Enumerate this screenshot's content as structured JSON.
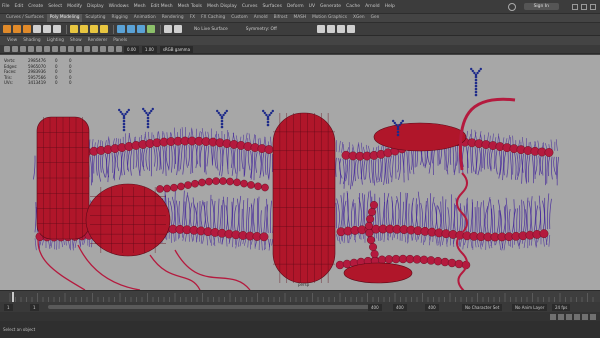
{
  "menubar": {
    "items": [
      "File",
      "Edit",
      "Create",
      "Select",
      "Modify",
      "Display",
      "Windows",
      "Mesh",
      "Edit Mesh",
      "Mesh Tools",
      "Mesh Display",
      "Curves",
      "Surfaces",
      "Deform",
      "UV",
      "Generate",
      "Cache",
      "Arnold",
      "Help"
    ],
    "sign_in": "Sign In"
  },
  "shelf_tabs": {
    "items": [
      "Curves / Surfaces",
      "Poly Modeling",
      "Sculpting",
      "Rigging",
      "Animation",
      "Rendering",
      "FX",
      "FX Caching",
      "Custom",
      "Arnold",
      "Bifrost",
      "MASH",
      "Motion Graphics",
      "XGen",
      "Gen"
    ],
    "active_index": 1
  },
  "status_line": {
    "surface_mode": "No Live Surface",
    "symmetry": "Symmetry: Off"
  },
  "viewport_menu": {
    "items": [
      "View",
      "Shading",
      "Lighting",
      "Show",
      "Renderer",
      "Panels"
    ]
  },
  "viewport_toolbar": {
    "exposure": "0.00",
    "gamma": "1.00",
    "color_space": "sRGB gamma"
  },
  "hud": {
    "rows": [
      {
        "label": "Verts:",
        "a": "2985476",
        "b": "0",
        "c": "0"
      },
      {
        "label": "Edges:",
        "a": "5965070",
        "b": "0",
        "c": "0"
      },
      {
        "label": "Faces:",
        "a": "2983936",
        "b": "0",
        "c": "0"
      },
      {
        "label": "Tris:",
        "a": "5957566",
        "b": "0",
        "c": "0"
      },
      {
        "label": "UVs:",
        "a": "3413419",
        "b": "0",
        "c": "0"
      }
    ]
  },
  "viewport": {
    "camera_label": "persp"
  },
  "range_slider": {
    "start": "1",
    "inner_start": "1",
    "inner_end": "400",
    "end_a": "400",
    "end_b": "400",
    "character_set": "No Character Set",
    "anim_layer": "No Anim Layer",
    "fps": "24 fps"
  },
  "status_bar": {
    "text": "Select an object"
  },
  "colors": {
    "accent": "#e08a2a",
    "protein": "#b0162a",
    "bead": "#b41a3e",
    "lipid_tail": "#3d1f9a",
    "glycan": "#1d2a8a",
    "viewport_bg": "#a7a7a7"
  }
}
